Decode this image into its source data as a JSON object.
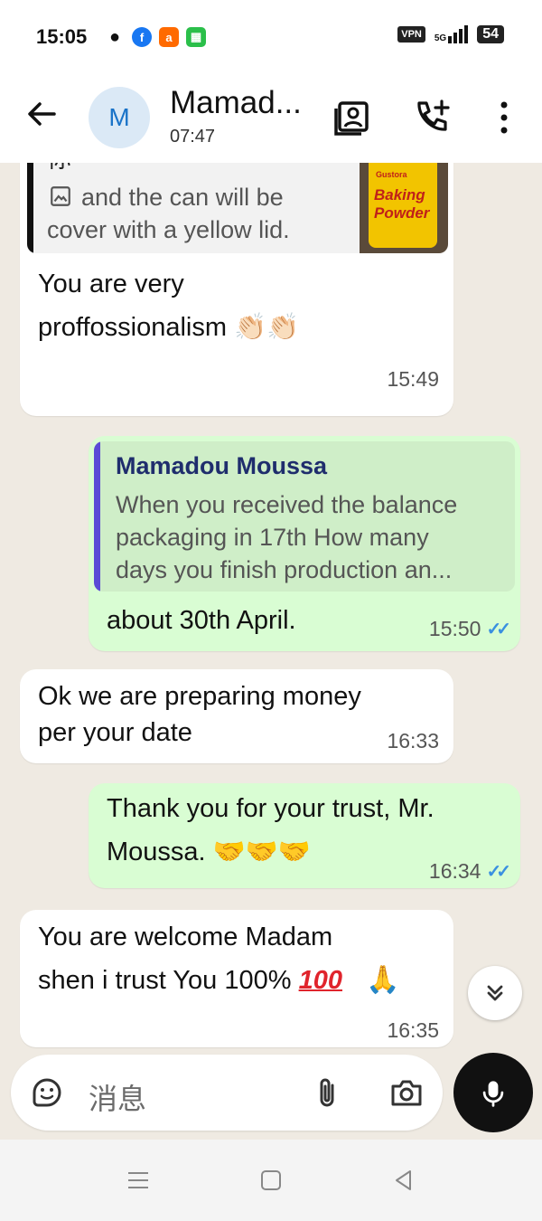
{
  "status_bar": {
    "time": "15:05",
    "apps": [
      {
        "icon": "wechat-icon",
        "glyph": "●",
        "color": "#111111"
      },
      {
        "icon": "facebook-icon",
        "glyph": "f",
        "color": "#1877f2"
      },
      {
        "icon": "alibaba-icon",
        "glyph": "a",
        "color": "#ff6a00"
      },
      {
        "icon": "qr-app-icon",
        "glyph": "▦",
        "color": "#2bbf4a"
      }
    ],
    "vpn": "VPN",
    "network": "5G",
    "battery": "54"
  },
  "header": {
    "avatar_letter": "M",
    "contact_name": "Mamad...",
    "last_seen": "07:47"
  },
  "messages": {
    "m1": {
      "quote_line1": "你",
      "quote_line2": "and the can will be",
      "quote_line3": "cover with a yellow lid.",
      "thumb_line1": "Gustora",
      "thumb_line2": "Baking",
      "thumb_line3": "Powder",
      "text_line1": "You are very",
      "text_line2": "proffossionalism 👏🏻👏🏻",
      "time": "15:49"
    },
    "m2": {
      "quote_sender": "Mamadou Moussa",
      "quote_line1": "When you received the balance",
      "quote_line2": "packaging in 17th How many",
      "quote_line3": "days  you finish production an...",
      "text": "about 30th April.",
      "time": "15:50"
    },
    "m3": {
      "text_line1": "Ok we are preparing money",
      "text_line2": "per your date",
      "time": "16:33"
    },
    "m4": {
      "text_line1": "Thank you for your trust, Mr.",
      "text_line2": "Moussa. 🤝🤝🤝",
      "time": "16:34"
    },
    "m5": {
      "text_line1": "You are welcome Madam",
      "text_line2": "shen i trust You 100%",
      "hundred": "100",
      "pray": "🙏",
      "time": "16:35"
    }
  },
  "composer": {
    "placeholder": "消息"
  },
  "colors": {
    "chat_bg": "#efeae2",
    "outgoing": "#d9fdd3",
    "incoming": "#ffffff",
    "read_ticks": "#3a90e0",
    "quote_bar_in": "#111111",
    "quote_bar_out": "#5b4bd6"
  }
}
